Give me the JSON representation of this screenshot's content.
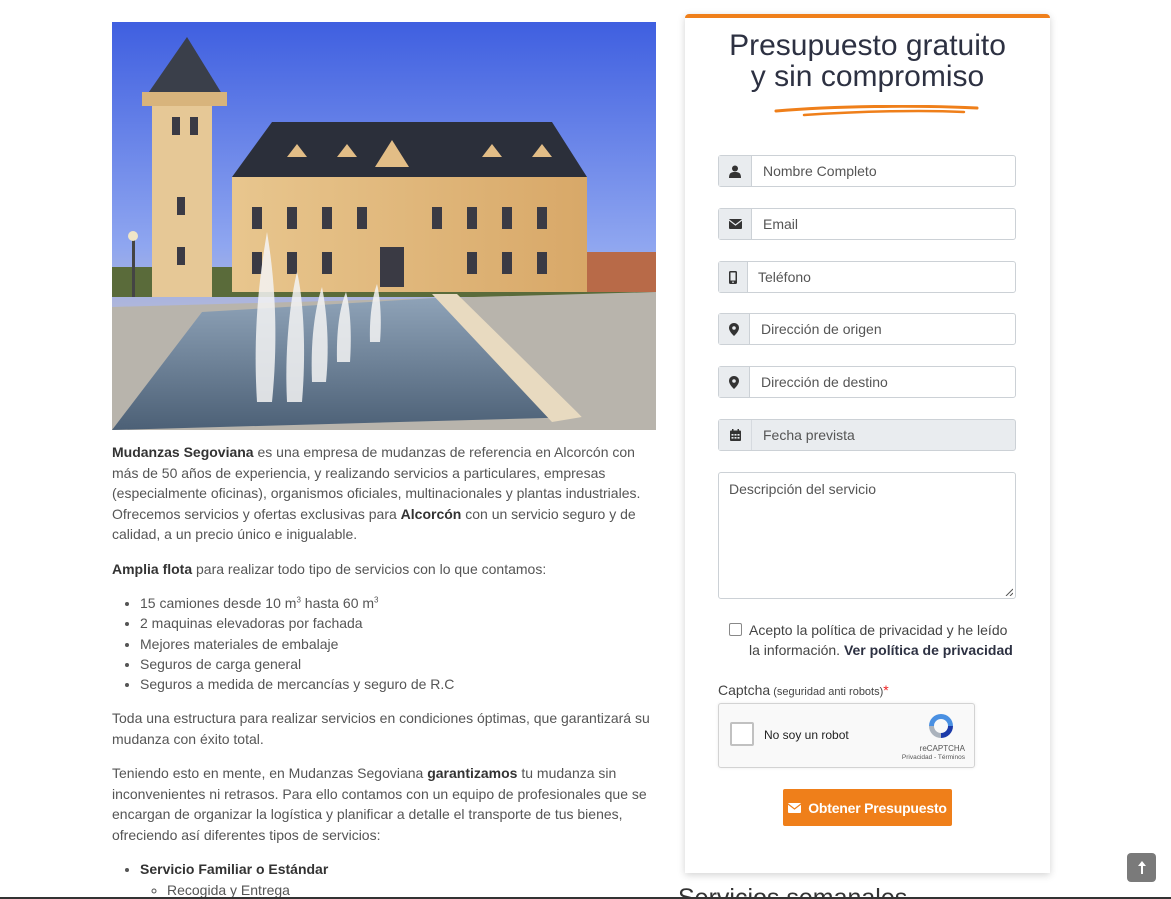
{
  "article": {
    "p1": {
      "brand": "Mudanzas Segoviana",
      "text_a": " es una empresa de mudanzas de referencia en Alcorcón con más de 50 años de experiencia, y realizando servicios a particulares, empresas (especialmente oficinas), organismos oficiales, multinacionales y plantas industriales. Ofrecemos servicios y ofertas exclusivas para ",
      "city": "Alcorcón",
      "text_b": " con un servicio seguro y de calidad, a un precio único e inigualable."
    },
    "p2": {
      "bold": "Amplia flota",
      "text": " para realizar todo tipo de servicios con lo que contamos:"
    },
    "fleet": {
      "item1_a": "15 camiones desde 10 m",
      "item1_sup1": "3",
      "item1_b": " hasta 60 m",
      "item1_sup2": "3",
      "item2": "2 maquinas elevadoras por fachada",
      "item3": "Mejores materiales de embalaje",
      "item4": "Seguros de carga general",
      "item5": "Seguros a medida de mercancías y seguro de R.C"
    },
    "p3": "Toda una estructura para realizar servicios en condiciones óptimas, que garantizará su mudanza con éxito total.",
    "p4": {
      "text_a": "Teniendo esto en mente, en Mudanzas Segoviana ",
      "bold": "garantizamos",
      "text_b": " tu mudanza sin inconvenientes ni retrasos. Para ello contamos con un equipo de profesionales que se encargan de organizar la logística y planificar a detalle el transporte de tus bienes, ofreciendo así diferentes tipos de servicios:"
    },
    "services": {
      "service1": "Servicio Familiar o Estándar",
      "service1_sub1": "Recogida y Entrega"
    },
    "next_heading": "Servicios semanales"
  },
  "form": {
    "title_line1": "Presupuesto gratuito",
    "title_line2": "y sin compromiso",
    "fields": {
      "name": "Nombre Completo",
      "email": "Email",
      "phone": "Teléfono",
      "origin": "Dirección de origen",
      "destination": "Dirección de destino",
      "date": "Fecha prevista",
      "description": "Descripción del servicio"
    },
    "consent": {
      "text": "Acepto la política de privacidad y he leído la información. ",
      "link": "Ver política de privacidad"
    },
    "captcha": {
      "label": "Captcha",
      "hint": " (seguridad anti robots)",
      "required": "*",
      "robot_text": "No soy un robot",
      "brand": "reCAPTCHA",
      "terms": "Privacidad - Términos"
    },
    "submit_label": "Obtener Presupuesto"
  },
  "colors": {
    "accent": "#ef7f1a",
    "title": "#2d3142"
  },
  "icons": [
    "user-icon",
    "envelope-icon",
    "mobile-icon",
    "map-marker-icon",
    "map-marker-icon",
    "calendar-icon",
    "envelope-icon",
    "arrow-up-icon",
    "recaptcha-logo-icon"
  ]
}
